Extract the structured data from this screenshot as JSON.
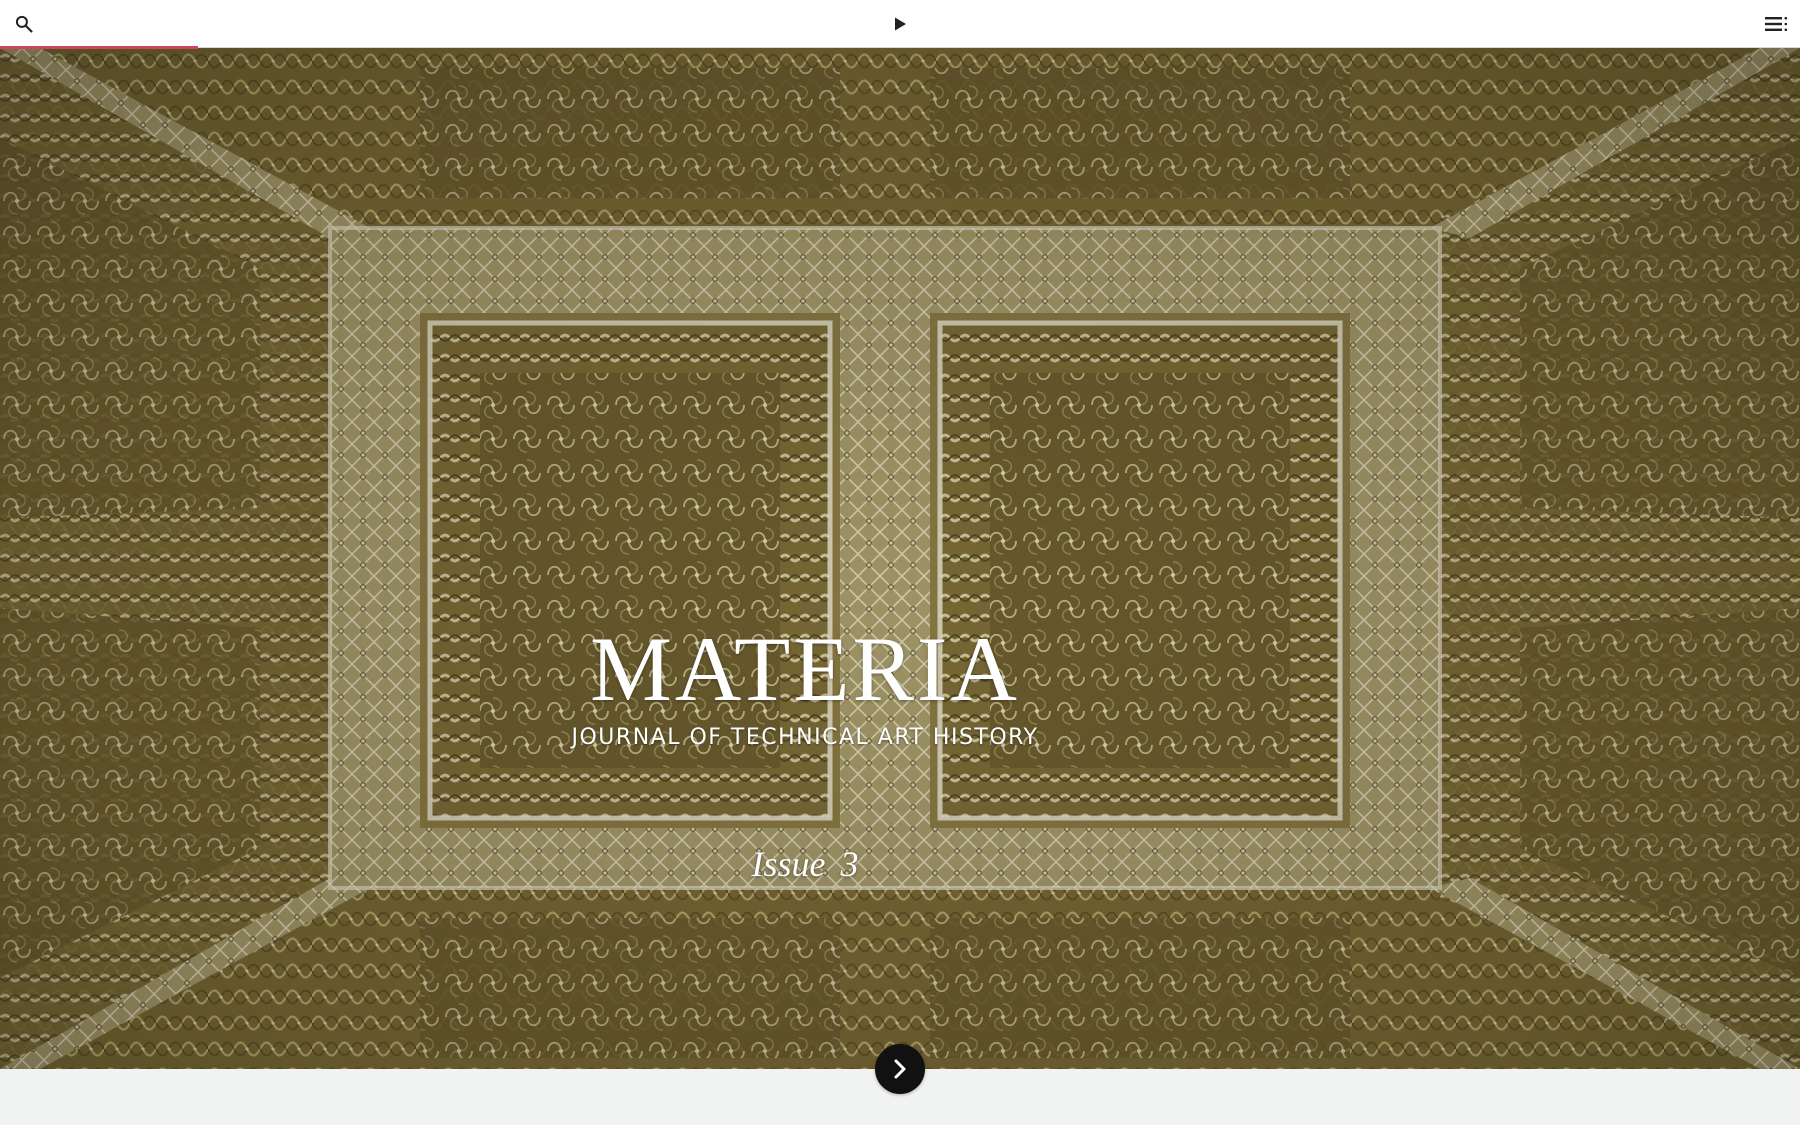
{
  "topbar": {
    "search_icon": "search-icon",
    "play_icon": "play-icon",
    "toc_icon": "table-of-contents-icon",
    "progress_fraction": 0.11,
    "accent_color": "#d0455a"
  },
  "hero": {
    "title": "MATERIA",
    "subtitle": "JOURNAL OF TECHNICAL ART HISTORY",
    "issue": "Issue 3",
    "next_icon": "chevron-right-icon",
    "background_colors": [
      "#7d6e3a",
      "#a59863",
      "#c8c09a"
    ]
  }
}
